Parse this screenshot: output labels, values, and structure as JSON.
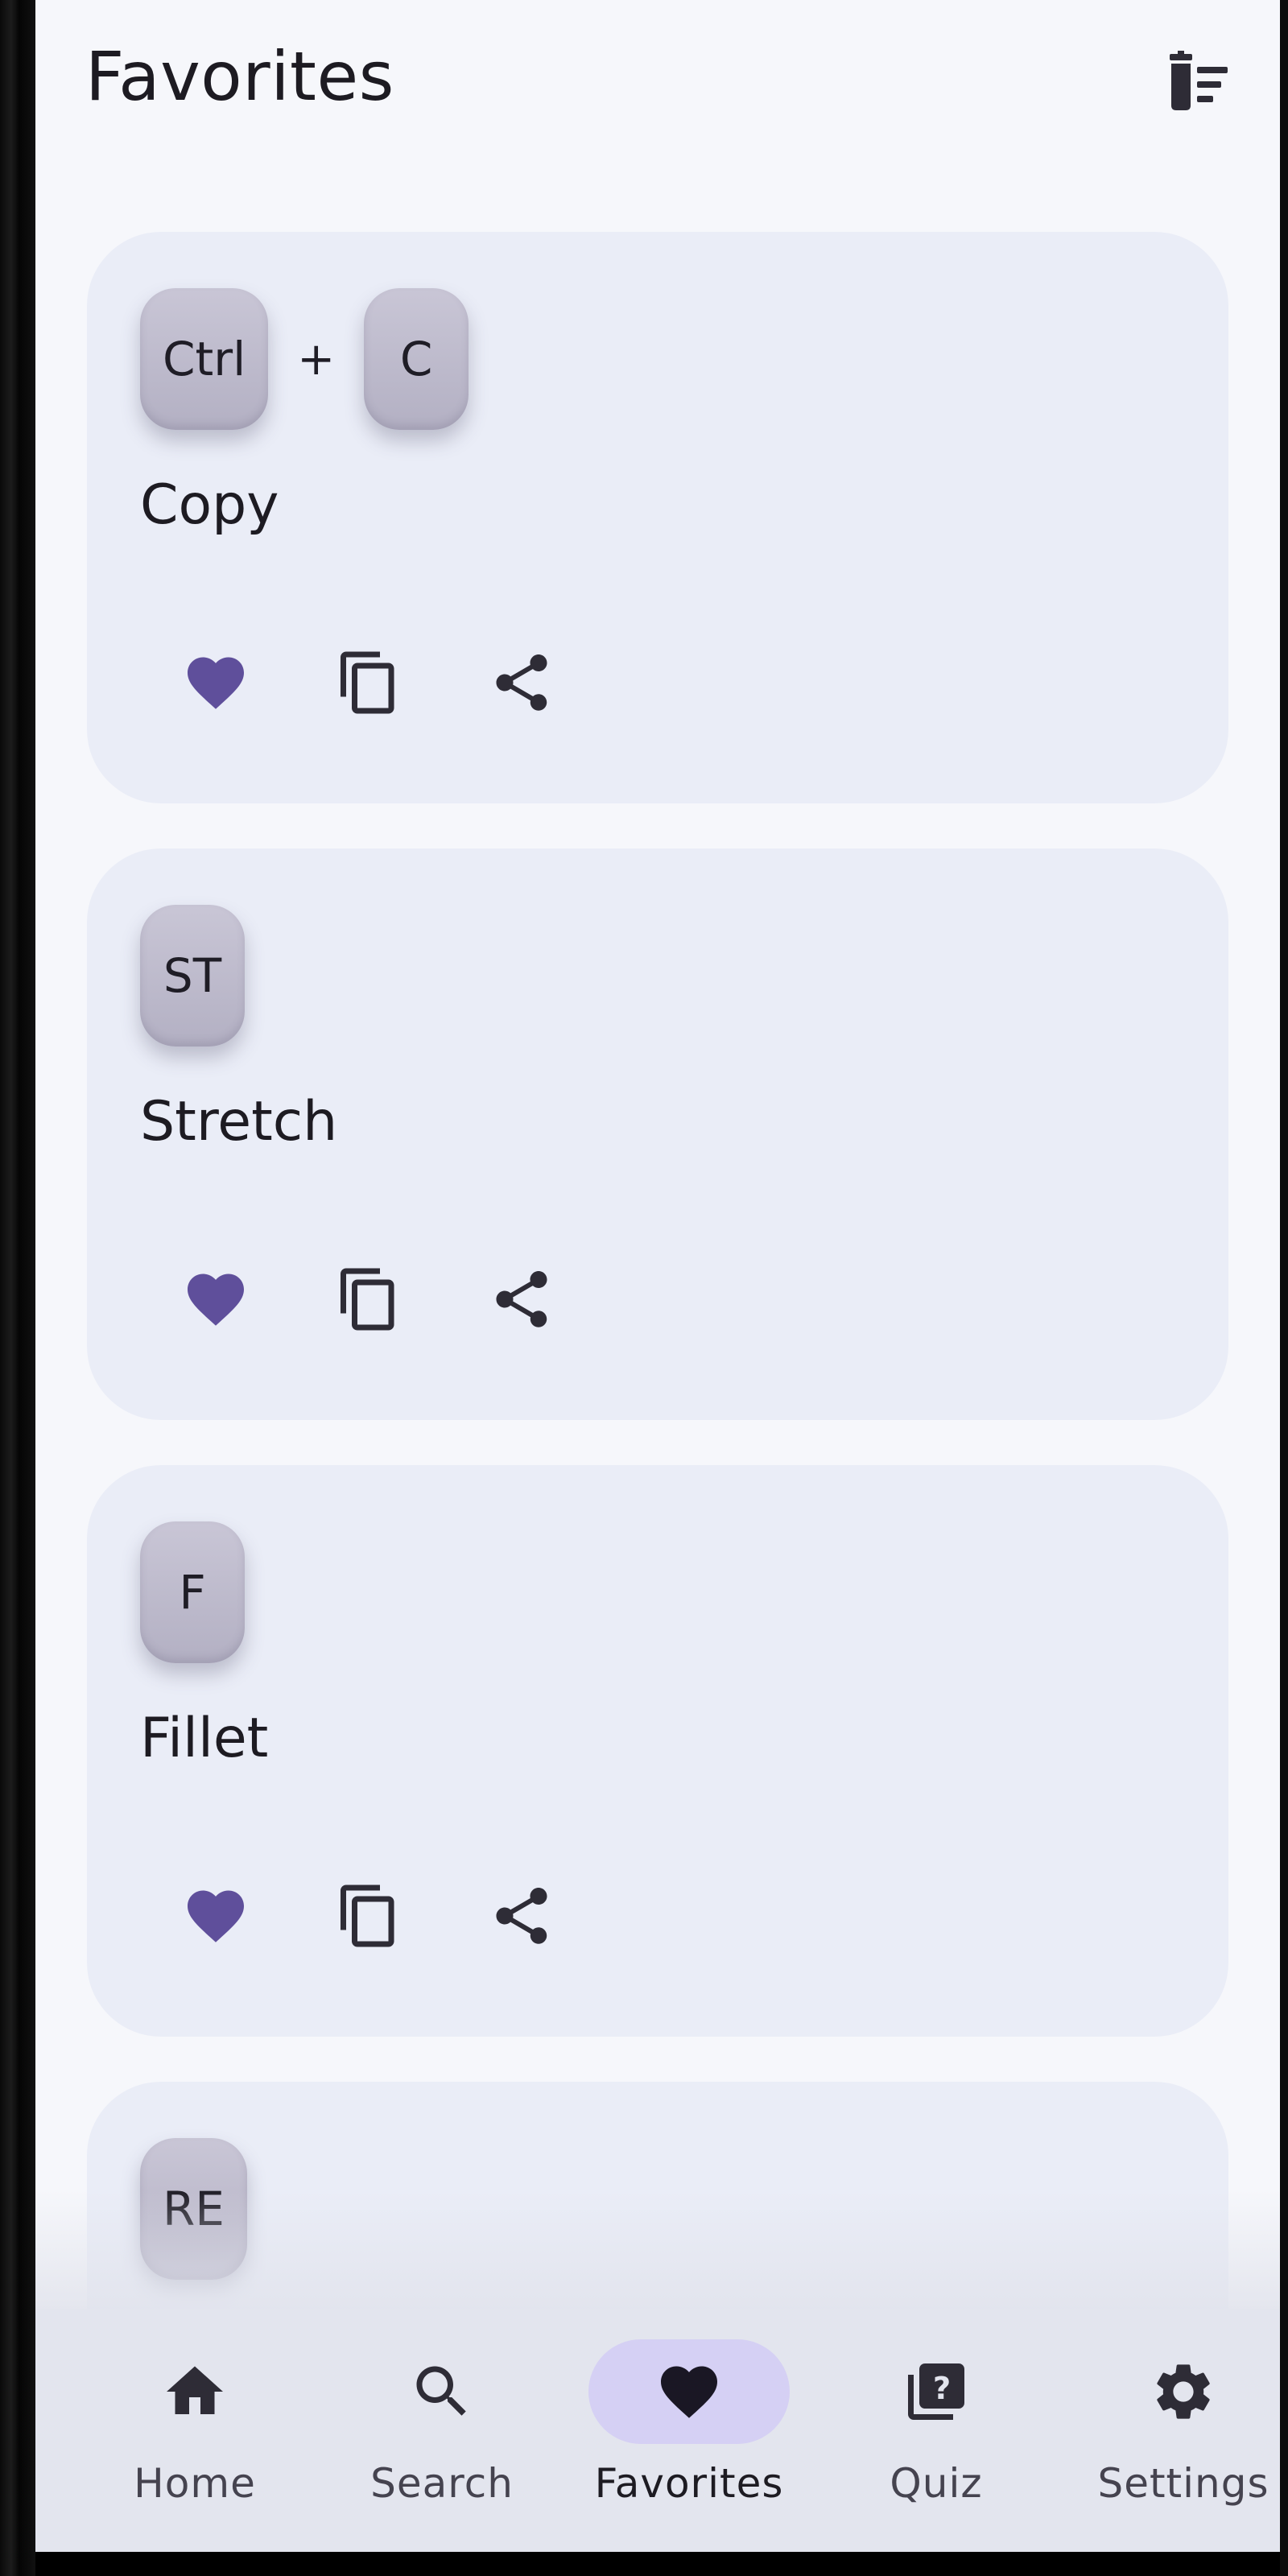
{
  "app": {
    "title": "Favorites"
  },
  "colors": {
    "accent": "#5f4f9b",
    "card_bg": "#eaedf7",
    "screen_bg": "#f6f7fb",
    "nav_active": "#d5d0f4"
  },
  "header": {
    "title": "Favorites",
    "clear_icon": "delete-sweep-icon"
  },
  "favorites": [
    {
      "keys": [
        "Ctrl",
        "C"
      ],
      "separator": "+",
      "label": "Copy"
    },
    {
      "keys": [
        "ST"
      ],
      "label": "Stretch"
    },
    {
      "keys": [
        "F"
      ],
      "label": "Fillet"
    },
    {
      "keys": [
        "RE"
      ],
      "label": ""
    }
  ],
  "card_actions": {
    "favorite_icon": "heart-icon",
    "copy_icon": "copy-icon",
    "share_icon": "share-icon"
  },
  "nav": {
    "active": "Favorites",
    "items": [
      {
        "label": "Home",
        "icon": "home-icon"
      },
      {
        "label": "Search",
        "icon": "search-icon"
      },
      {
        "label": "Favorites",
        "icon": "heart-icon"
      },
      {
        "label": "Quiz",
        "icon": "quiz-icon"
      },
      {
        "label": "Settings",
        "icon": "gear-icon"
      }
    ]
  }
}
